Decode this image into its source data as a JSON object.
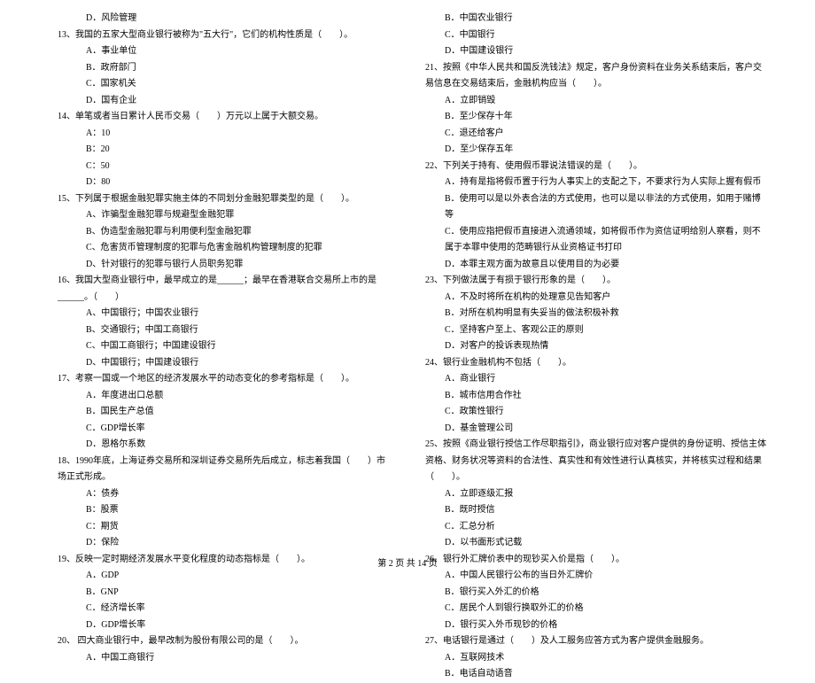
{
  "left": {
    "q12d": "D．风险管理",
    "q13": "13、我国的五家大型商业银行被称为\"五大行\"，它们的机构性质是（　　）。",
    "q13a": "A．事业单位",
    "q13b": "B．政府部门",
    "q13c": "C．国家机关",
    "q13d": "D．国有企业",
    "q14": "14、单笔或者当日累计人民币交易（　　）万元以上属于大额交易。",
    "q14a": "A：10",
    "q14b": "B：20",
    "q14c": "C：50",
    "q14d": "D：80",
    "q15": "15、下列属于根据金融犯罪实施主体的不同划分金融犯罪类型的是（　　）。",
    "q15a": "A、诈骗型金融犯罪与规避型金融犯罪",
    "q15b": "B、伪造型金融犯罪与利用便利型金融犯罪",
    "q15c": "C、危害货币管理制度的犯罪与危害金融机构管理制度的犯罪",
    "q15d": "D、针对银行的犯罪与银行人员职务犯罪",
    "q16": "16、我国大型商业银行中，最早成立的是______；最早在香港联合交易所上市的是______。（　　）",
    "q16a": "A、中国银行；中国农业银行",
    "q16b": "B、交通银行；中国工商银行",
    "q16c": "C、中国工商银行；中国建设银行",
    "q16d": "D、中国银行；中国建设银行",
    "q17": "17、考察一国或一个地区的经济发展水平的动态变化的参考指标是（　　）。",
    "q17a": "A．年度进出口总额",
    "q17b": "B．国民生产总值",
    "q17c": "C．GDP增长率",
    "q17d": "D．恩格尔系数",
    "q18": "18、1990年底，上海证券交易所和深圳证券交易所先后成立，标志着我国（　　）市场正式形成。",
    "q18a": "A：债券",
    "q18b": "B：股票",
    "q18c": "C：期货",
    "q18d": "D：保险",
    "q19": "19、反映一定时期经济发展水平变化程度的动态指标是（　　）。",
    "q19a": "A．GDP",
    "q19b": "B．GNP",
    "q19c": "C．经济增长率",
    "q19d": "D．GDP增长率",
    "q20": "20、 四大商业银行中，最早改制为股份有限公司的是（　　）。",
    "q20a": "A．中国工商银行"
  },
  "right": {
    "q20b": "B．中国农业银行",
    "q20c": "C．中国银行",
    "q20d": "D．中国建设银行",
    "q21": "21、按照《中华人民共和国反洗钱法》规定，客户身份资料在业务关系结束后，客户交易信息在交易结束后，金融机构应当（　　）。",
    "q21a": "A．立即销毁",
    "q21b": "B．至少保存十年",
    "q21c": "C．退还给客户",
    "q21d": "D．至少保存五年",
    "q22": "22、下列关于持有、使用假币罪说法错误的是（　　）。",
    "q22a": "A．持有是指将假币置于行为人事实上的支配之下，不要求行为人实际上握有假币",
    "q22b": "B．使用可以是以外表合法的方式使用，也可以是以非法的方式使用，如用于赌博等",
    "q22c": "C．使用应指把假币直接进入流通领域，如将假币作为资信证明给别人察看，则不属于本罪中使用的范畴银行从业资格证书打印",
    "q22d": "D．本罪主观方面为故意且以使用目的为必要",
    "q23": "23、下列做法属于有损于银行形象的是（　　）。",
    "q23a": "A．不及时将所在机构的处理意见告知客户",
    "q23b": "B．对所在机构明显有失妥当的做法积极补救",
    "q23c": "C．坚持客户至上、客观公正的原则",
    "q23d": "D．对客户的投诉表现热情",
    "q24": "24、银行业金融机构不包括（　　）。",
    "q24a": "A．商业银行",
    "q24b": "B．城市信用合作社",
    "q24c": "C．政策性银行",
    "q24d": "D．基金管理公司",
    "q25": "25、按照《商业银行授信工作尽职指引》，商业银行应对客户提供的身份证明、授信主体资格、财务状况等资料的合法性、真实性和有效性进行认真核实，并将核实过程和结果（　　）。",
    "q25a": "A．立即逐级汇报",
    "q25b": "B．既时授信",
    "q25c": "C．汇总分析",
    "q25d": "D．以书面形式记载",
    "q26": "26、银行外汇牌价表中的现钞买入价是指（　　）。",
    "q26a": "A．中国人民银行公布的当日外汇牌价",
    "q26b": "B．银行买入外汇的价格",
    "q26c": "C．居民个人到银行换取外汇的价格",
    "q26d": "D．银行买入外币现钞的价格",
    "q27": "27、电话银行是通过（　　）及人工服务应答方式为客户提供金融服务。",
    "q27a": "A．互联网技术",
    "q27b": "B．电话自动语音"
  },
  "footer": "第 2 页 共 14 页"
}
